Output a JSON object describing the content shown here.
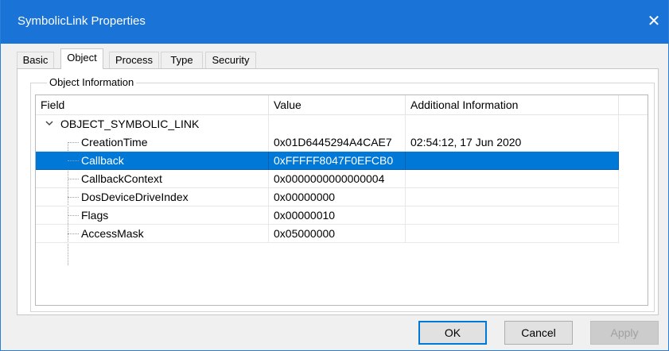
{
  "window": {
    "title": "SymbolicLink Properties",
    "close_glyph": "✕"
  },
  "tabs": [
    {
      "label": "Basic",
      "active": false
    },
    {
      "label": "Object",
      "active": true
    },
    {
      "label": "Process",
      "active": false
    },
    {
      "label": "Type",
      "active": false
    },
    {
      "label": "Security",
      "active": false
    }
  ],
  "group": {
    "label": "Object Information"
  },
  "list": {
    "columns": [
      "Field",
      "Value",
      "Additional Information"
    ],
    "root": {
      "label": "OBJECT_SYMBOLIC_LINK",
      "expanded": true
    },
    "rows": [
      {
        "field": "CreationTime",
        "value": "0x01D6445294A4CAE7",
        "info": "02:54:12, 17 Jun 2020",
        "selected": false
      },
      {
        "field": "Callback",
        "value": "0xFFFFF8047F0EFCB0",
        "info": "",
        "selected": true
      },
      {
        "field": "CallbackContext",
        "value": "0x0000000000000004",
        "info": "",
        "selected": false
      },
      {
        "field": "DosDeviceDriveIndex",
        "value": "0x00000000",
        "info": "",
        "selected": false
      },
      {
        "field": "Flags",
        "value": "0x00000010",
        "info": "",
        "selected": false
      },
      {
        "field": "AccessMask",
        "value": "0x05000000",
        "info": "",
        "selected": false
      }
    ]
  },
  "buttons": {
    "ok": "OK",
    "cancel": "Cancel",
    "apply": "Apply"
  },
  "colors": {
    "titlebar": "#1a73d6",
    "selection": "#0078d7"
  }
}
